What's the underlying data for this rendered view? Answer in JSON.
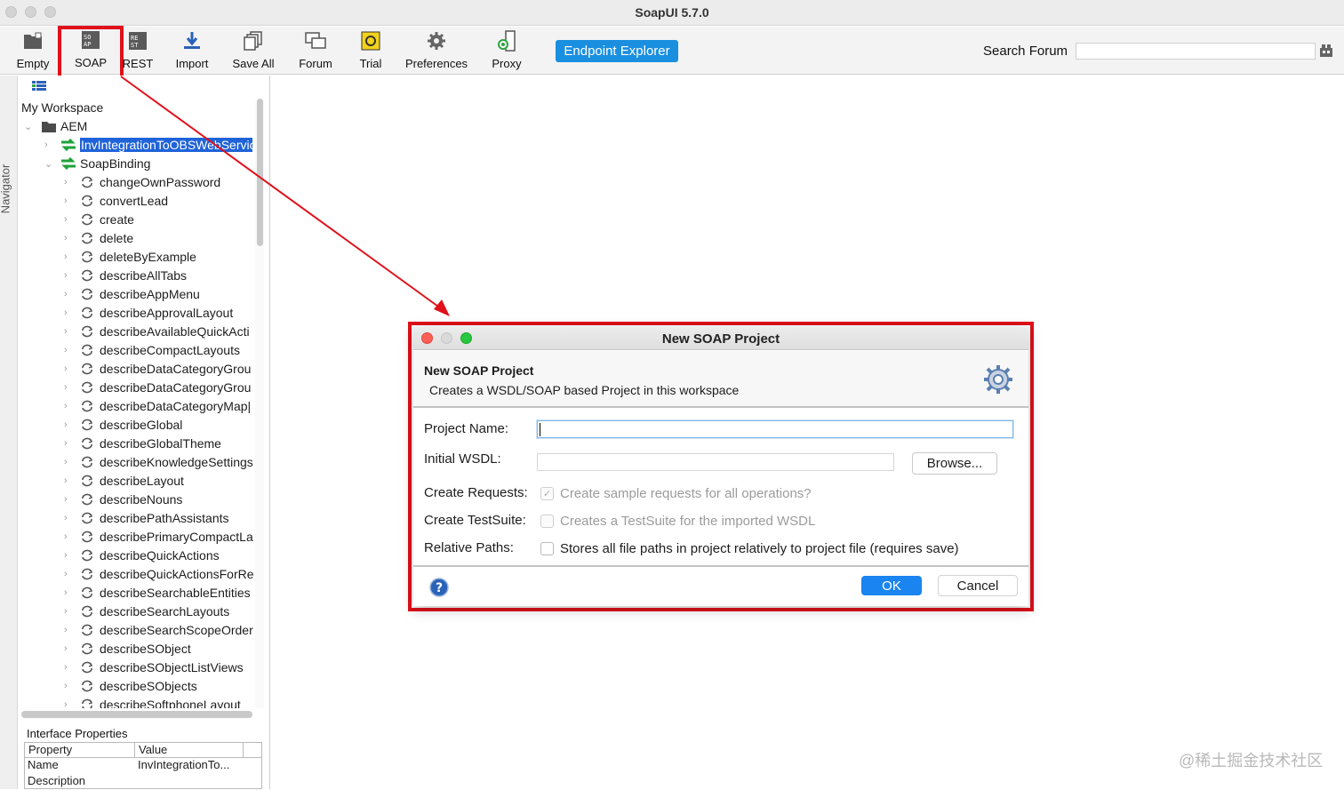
{
  "window": {
    "title": "SoapUI 5.7.0"
  },
  "toolbar": {
    "buttons": [
      {
        "label": "Empty",
        "icon": "empty-project-icon"
      },
      {
        "label": "SOAP",
        "icon": "soap-project-icon"
      },
      {
        "label": "REST",
        "icon": "rest-project-icon"
      },
      {
        "label": "Import",
        "icon": "import-icon"
      },
      {
        "label": "Save All",
        "icon": "save-all-icon"
      },
      {
        "label": "Forum",
        "icon": "forum-icon"
      },
      {
        "label": "Trial",
        "icon": "trial-icon"
      },
      {
        "label": "Preferences",
        "icon": "gear-icon"
      },
      {
        "label": "Proxy",
        "icon": "proxy-icon"
      }
    ],
    "endpoint_explorer": "Endpoint Explorer",
    "search_label": "Search Forum",
    "search_value": ""
  },
  "navigator": {
    "tab_label": "Navigator",
    "workspace": "My Workspace",
    "project": "AEM",
    "interfaces": [
      "InvIntegrationToOBSWebService",
      "SoapBinding"
    ],
    "operations": [
      "changeOwnPassword",
      "convertLead",
      "create",
      "delete",
      "deleteByExample",
      "describeAllTabs",
      "describeAppMenu",
      "describeApprovalLayout",
      "describeAvailableQuickActi",
      "describeCompactLayouts",
      "describeDataCategoryGrou",
      "describeDataCategoryGrou",
      "describeDataCategoryMap|",
      "describeGlobal",
      "describeGlobalTheme",
      "describeKnowledgeSettings",
      "describeLayout",
      "describeNouns",
      "describePathAssistants",
      "describePrimaryCompactLa",
      "describeQuickActions",
      "describeQuickActionsForRe",
      "describeSearchableEntities",
      "describeSearchLayouts",
      "describeSearchScopeOrder",
      "describeSObject",
      "describeSObjectListViews",
      "describeSObjects",
      "describeSoftphoneLayout"
    ]
  },
  "properties": {
    "title": "Interface Properties",
    "headers": [
      "Property",
      "Value"
    ],
    "rows": [
      {
        "property": "Name",
        "value": "InvIntegrationTo..."
      },
      {
        "property": "Description",
        "value": ""
      }
    ]
  },
  "dialog": {
    "title": "New SOAP Project",
    "header_title": "New SOAP Project",
    "header_subtitle": "Creates a WSDL/SOAP based Project in this workspace",
    "fields": {
      "project_name_label": "Project Name:",
      "project_name_value": "",
      "initial_wsdl_label": "Initial WSDL:",
      "initial_wsdl_value": "",
      "browse_label": "Browse...",
      "create_requests_label": "Create Requests:",
      "create_requests_text": "Create sample requests for all operations?",
      "create_testsuite_label": "Create TestSuite:",
      "create_testsuite_text": "Creates a TestSuite for the imported WSDL",
      "relative_paths_label": "Relative Paths:",
      "relative_paths_text": "Stores all file paths in project relatively to project file (requires save)"
    },
    "ok_label": "OK",
    "cancel_label": "Cancel"
  },
  "watermark": "@稀土掘金技术社区",
  "colors": {
    "accent_blue": "#1a84f0",
    "annotation_red": "#e0101a",
    "selection_blue": "#1f63d8"
  }
}
